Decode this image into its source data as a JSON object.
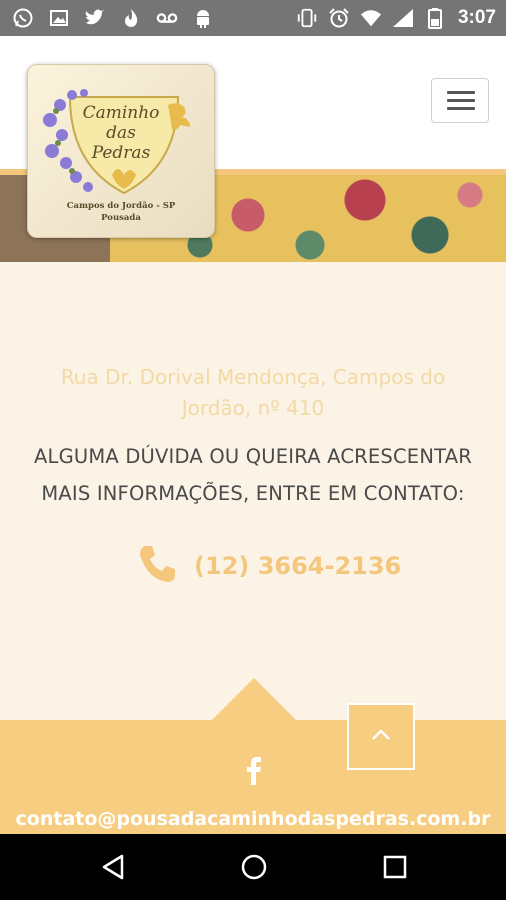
{
  "status_bar": {
    "time": "3:07",
    "left_icons": [
      "whatsapp-icon",
      "image-icon",
      "twitter-icon",
      "fire-icon",
      "voicemail-icon",
      "android-icon"
    ],
    "right_icons": [
      "vibrate-icon",
      "alarm-icon",
      "wifi-icon",
      "signal-icon",
      "battery-icon"
    ]
  },
  "header": {
    "logo": {
      "line1": "Caminho",
      "line2": "das",
      "line3": "Pedras",
      "city": "Campos do Jordão - SP",
      "tagline": "Pousada"
    },
    "menu_icon": "hamburger-icon"
  },
  "contact": {
    "address": "Rua Dr. Dorival Mendonça, Campos do Jordão, nº 410",
    "question": "ALGUMA DÚVIDA OU QUEIRA ACRESCENTAR MAIS INFORMAÇÕES, ENTRE EM CONTATO:",
    "phone": "(12) 3664-2136"
  },
  "footer": {
    "social_icon": "facebook-icon",
    "back_to_top_icon": "chevron-up-icon",
    "email": "contato@pousadacaminhodaspedras.com.br"
  },
  "nav_bar": {
    "buttons": [
      "back-icon",
      "home-icon",
      "recents-icon"
    ]
  },
  "colors": {
    "accent": "#f5c77c",
    "footer": "#f7cd81",
    "page_bg": "#fbf3e6",
    "text": "#4a4a4a"
  }
}
